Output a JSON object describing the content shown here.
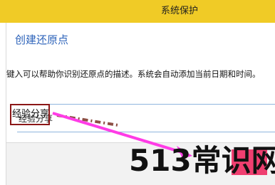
{
  "window": {
    "title": "系统保护"
  },
  "dialog": {
    "heading": "创建还原点",
    "description": "键入可以帮助你识别还原点的描述。系统会自动添加当前日期和时间。",
    "restore_point_name": "经验分享"
  },
  "watermark": {
    "text": "513常识网"
  },
  "colors": {
    "titlebar": "#f0cb26",
    "heading": "#2d63ba",
    "highlight_border": "#8b1717",
    "arrow": "#ff3ce6"
  }
}
